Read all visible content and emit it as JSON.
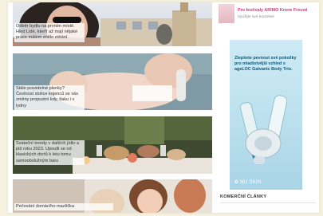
{
  "articles": [
    {
      "caption": "Odběr bydlu na prvním místě. Hled Lidé, kterří až mají nějaké práce málem znělo zdrání."
    },
    {
      "caption": "Stále pravidelné plenky? Čestnost stolice kojenců se vás změny propustní kdy, tlaku i v lydny"
    },
    {
      "caption": "Sváteční trendy v dalších jídlo a pití roku 2023. Upoutli se od klasických dortů k letu tomu samoobslužným baru"
    },
    {
      "caption": "Pečování domácího mazlíčka"
    }
  ],
  "promo": {
    "title": "Pro festivaly ARIMO Krone Freuwi",
    "subtitle": "Využijte své kouzelné"
  },
  "ad": {
    "headline": "Zlepšete pevnost své pokožky pro mladistvější vzhled s ageLOC Galvanic Body Trio.",
    "brand": "NU SKIN"
  },
  "sidebar": {
    "section_title": "KOMERČNÍ ČLÁNKY"
  }
}
